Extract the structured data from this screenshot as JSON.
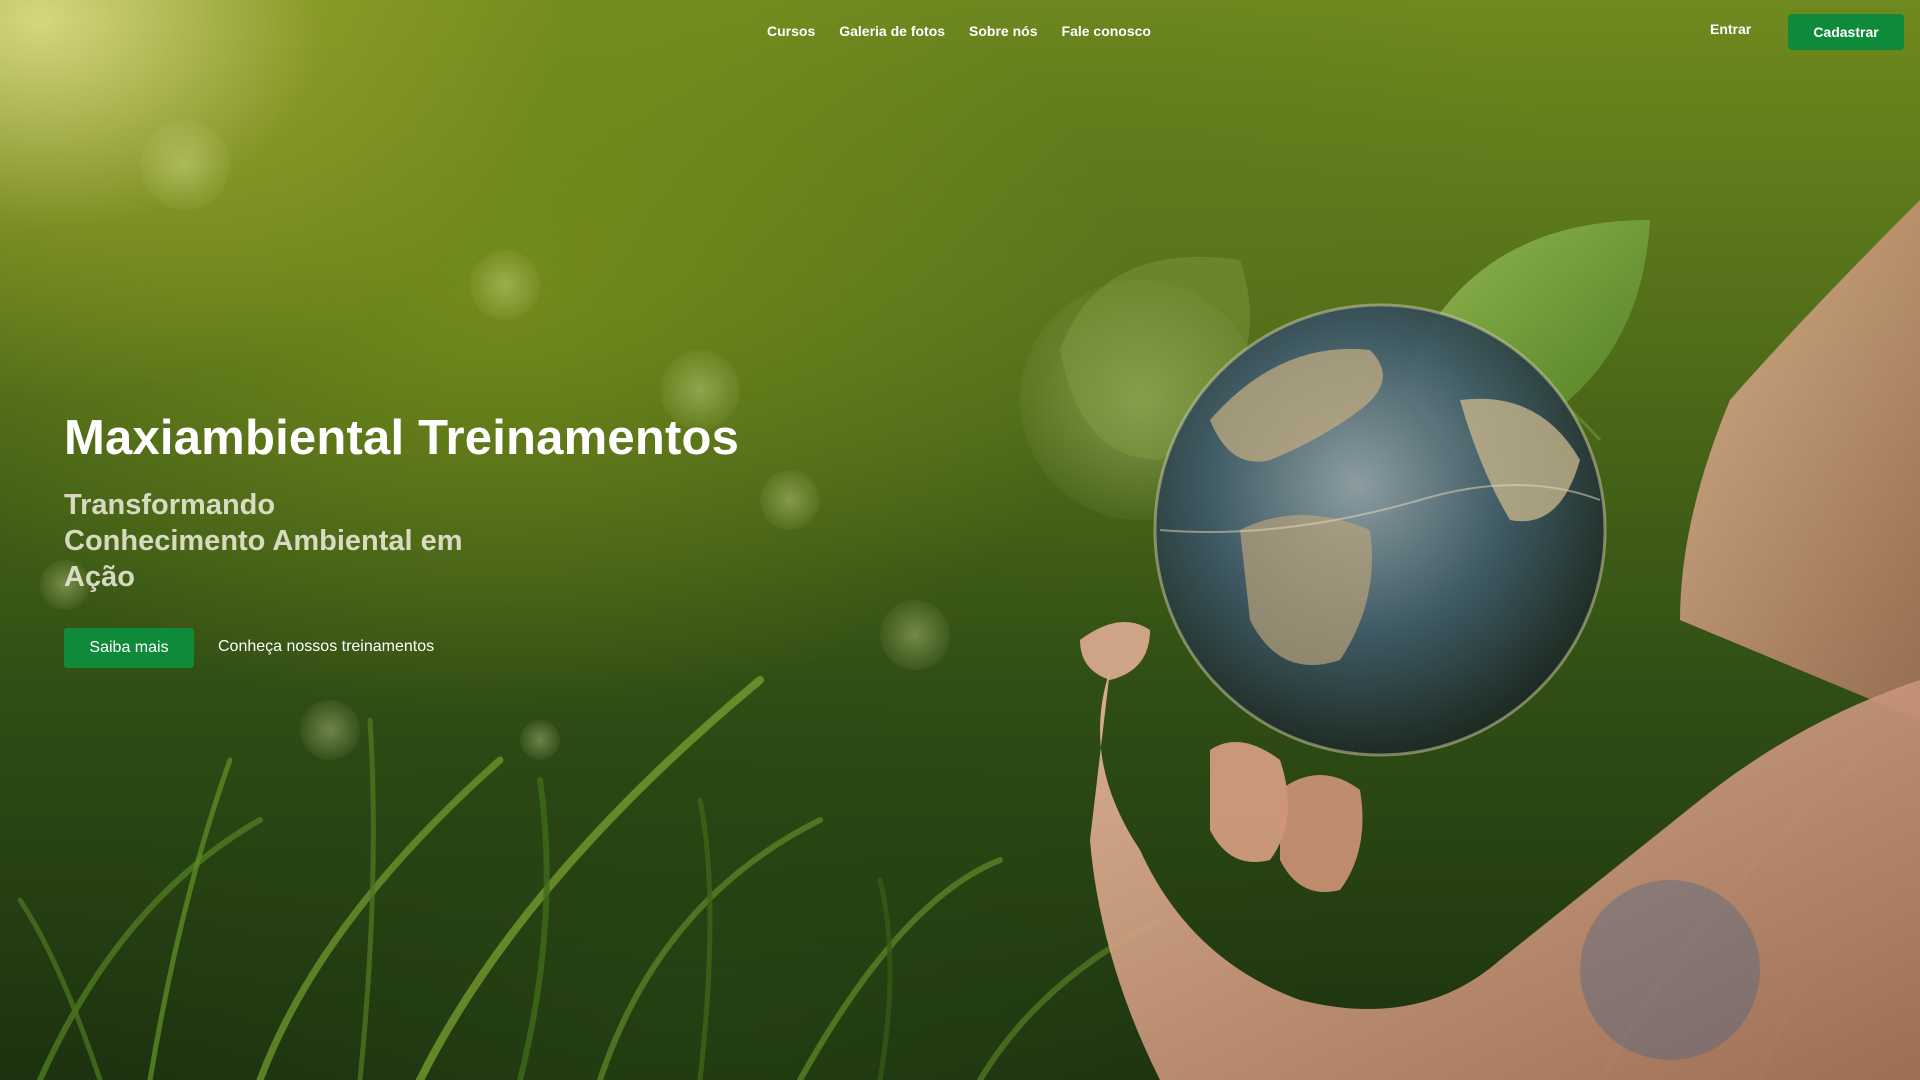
{
  "nav": {
    "links": [
      {
        "label": "Cursos"
      },
      {
        "label": "Galeria de fotos"
      },
      {
        "label": "Sobre nós"
      },
      {
        "label": "Fale conosco"
      }
    ],
    "login_label": "Entrar",
    "signup_label": "Cadastrar"
  },
  "hero": {
    "title": "Maxiambiental Treinamentos",
    "subtitle": "Transformando Conhecimento Ambiental em Ação",
    "primary_cta": "Saiba mais",
    "secondary_cta": "Conheça nossos treinamentos",
    "background_image": "hands-holding-glass-globe-in-grass"
  },
  "colors": {
    "accent": "#0f8a3a",
    "text": "#ffffff"
  }
}
